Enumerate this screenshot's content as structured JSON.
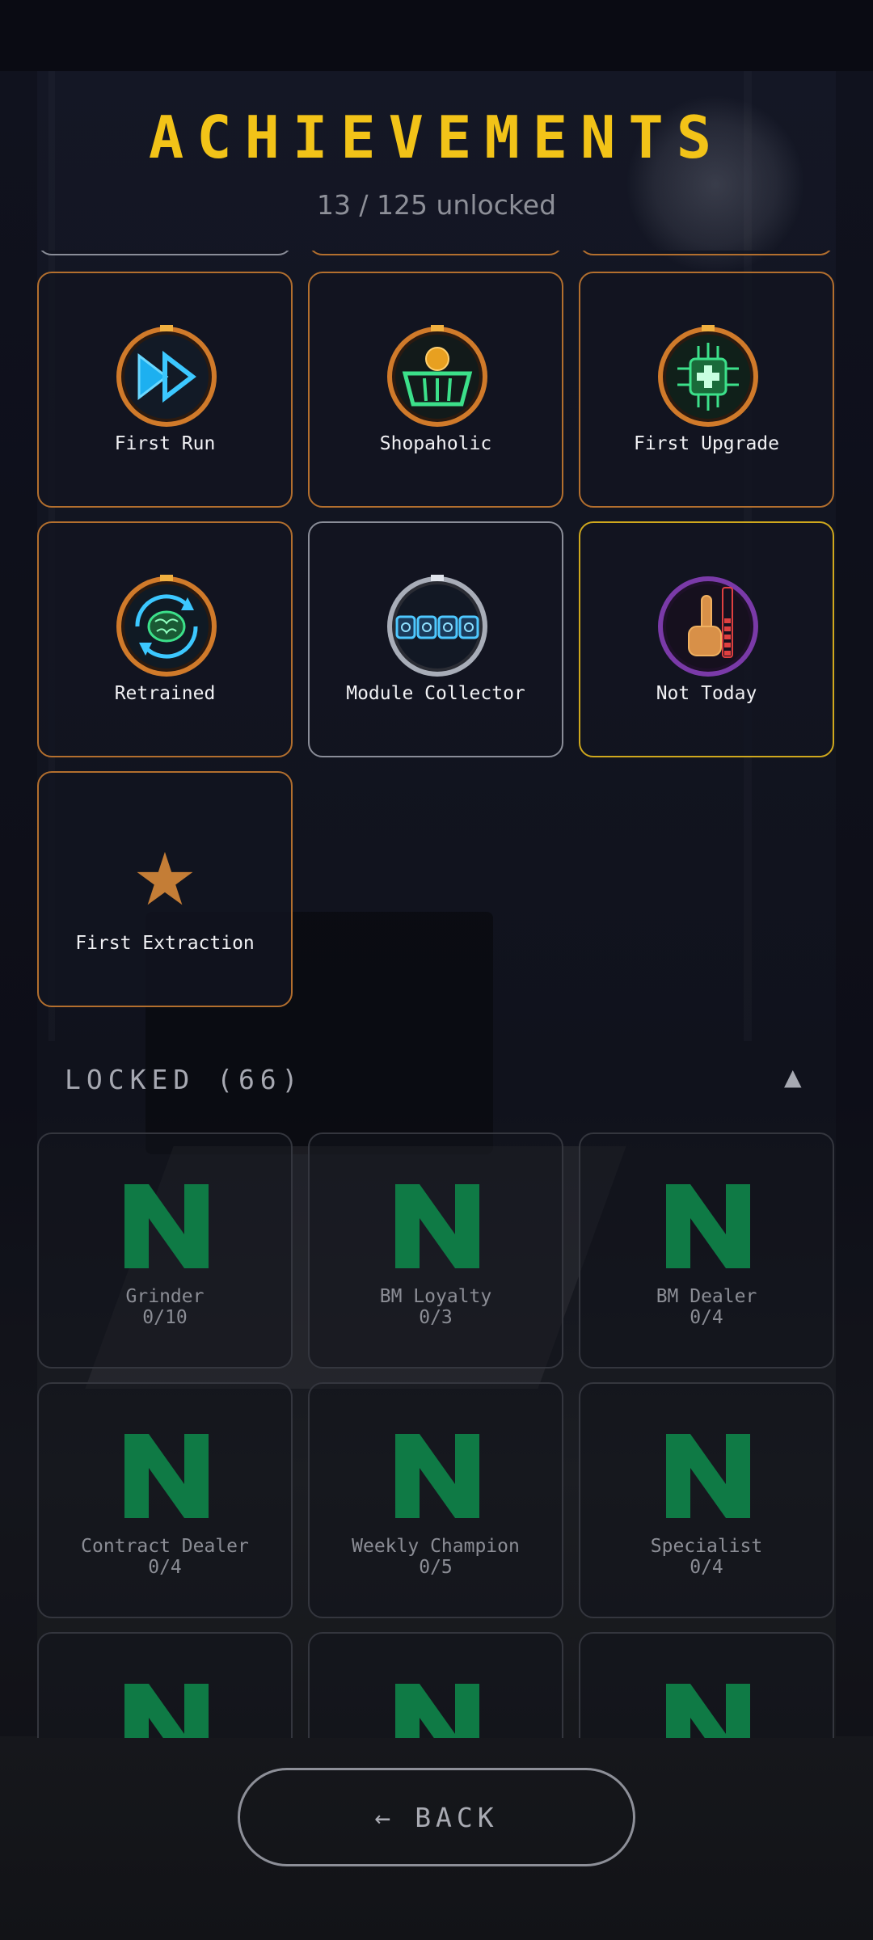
{
  "header": {
    "title": "ACHIEVEMENTS",
    "progress_text": "13 / 125 unlocked"
  },
  "unlocked": [
    {
      "name": "First Run",
      "icon": "fast-forward-icon",
      "tier": "bronze"
    },
    {
      "name": "Shopaholic",
      "icon": "shopping-basket-icon",
      "tier": "bronze"
    },
    {
      "name": "First Upgrade",
      "icon": "chip-upgrade-icon",
      "tier": "bronze"
    },
    {
      "name": "Retrained",
      "icon": "brain-refresh-icon",
      "tier": "bronze"
    },
    {
      "name": "Module Collector",
      "icon": "modules-icon",
      "tier": "silver"
    },
    {
      "name": "Not Today",
      "icon": "middle-finger-icon",
      "tier": "gold"
    },
    {
      "name": "First Extraction",
      "icon": "star-icon",
      "tier": "bronze"
    }
  ],
  "locked_section": {
    "label": "LOCKED (66)",
    "toggle_icon": "collapse-triangle-icon"
  },
  "locked": [
    {
      "name": "Grinder",
      "progress": "0/10"
    },
    {
      "name": "BM Loyalty",
      "progress": "0/3"
    },
    {
      "name": "BM Dealer",
      "progress": "0/4"
    },
    {
      "name": "Contract Dealer",
      "progress": "0/4"
    },
    {
      "name": "Weekly Champion",
      "progress": "0/5"
    },
    {
      "name": "Specialist",
      "progress": "0/4"
    }
  ],
  "back_button": {
    "arrow": "←",
    "label": "BACK"
  },
  "colors": {
    "gold": "#f2c318",
    "bronze_border": "#b36f2e",
    "silver_border": "#8a8d98",
    "gold_border": "#cfa81d",
    "locked_icon": "#0f7a45"
  }
}
